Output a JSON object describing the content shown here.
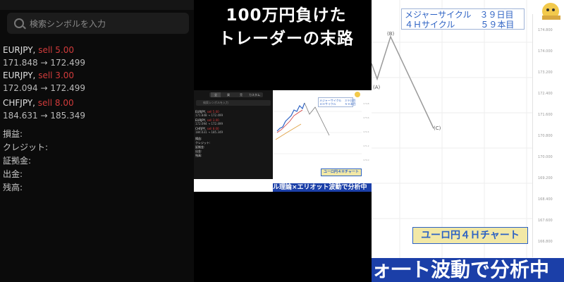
{
  "title": {
    "line1": "100万円負けた",
    "line2": "トレーダーの末路"
  },
  "left_panel": {
    "search_placeholder": "検索シンボルを入力",
    "positions": [
      {
        "symbol": "EURJPY,",
        "side": "sell 5.00",
        "price_from": "171.848",
        "arrow": "→",
        "price_to": "172.499"
      },
      {
        "symbol": "EURJPY,",
        "side": "sell 3.00",
        "price_from": "172.094",
        "arrow": "→",
        "price_to": "172.499"
      },
      {
        "symbol": "CHFJPY,",
        "side": "sell 8.00",
        "price_from": "184.631",
        "arrow": "→",
        "price_to": "185.349"
      }
    ],
    "labels": [
      "損益:",
      "クレジット:",
      "証拠金:",
      "出金:",
      "残高:"
    ]
  },
  "right_chart": {
    "badge_lines": [
      "メジャーサイクル　３９日目",
      "４Ｈサイクル　　　５９本目"
    ],
    "wave_labels": [
      "(B)",
      "(A)",
      "(C)"
    ],
    "bottom_badge": "ユーロ円４Ｈチャート",
    "bottom_banner": "ォ一ト波動で分析中"
  },
  "center_screenshot": {
    "tabs": [
      "全",
      "買",
      "売",
      "カスタム"
    ],
    "search_placeholder": "検索シンボルを入力",
    "positions": [
      {
        "symbol": "EURJPY,",
        "side": "sell 5.00",
        "price_from": "171.848",
        "arrow": "→",
        "price_to": "172.499"
      },
      {
        "symbol": "EURJPY,",
        "side": "sell 3.00",
        "price_from": "172.094",
        "arrow": "→",
        "price_to": "172.499"
      },
      {
        "symbol": "CHFJPY,",
        "side": "sell 8.00",
        "price_from": "184.631",
        "arrow": "→",
        "price_to": "185.349"
      }
    ],
    "labels": [
      "損益:",
      "クレジット:",
      "証拠金:",
      "出金:",
      "残高:"
    ],
    "badge_lines": [
      "メジャーサイクル　３９日目",
      "４Ｈサイクル　　　５９本目"
    ],
    "bottom_badge": "ユーロ円４Ｈチャート",
    "caption": "ル理論×エリオット波動で分析中"
  },
  "colors": {
    "sell_red": "#d23b3b",
    "banner_blue": "#1b3fa8",
    "badge_blue": "#2d62c4",
    "badge_yellow": "#f2e8a6"
  }
}
